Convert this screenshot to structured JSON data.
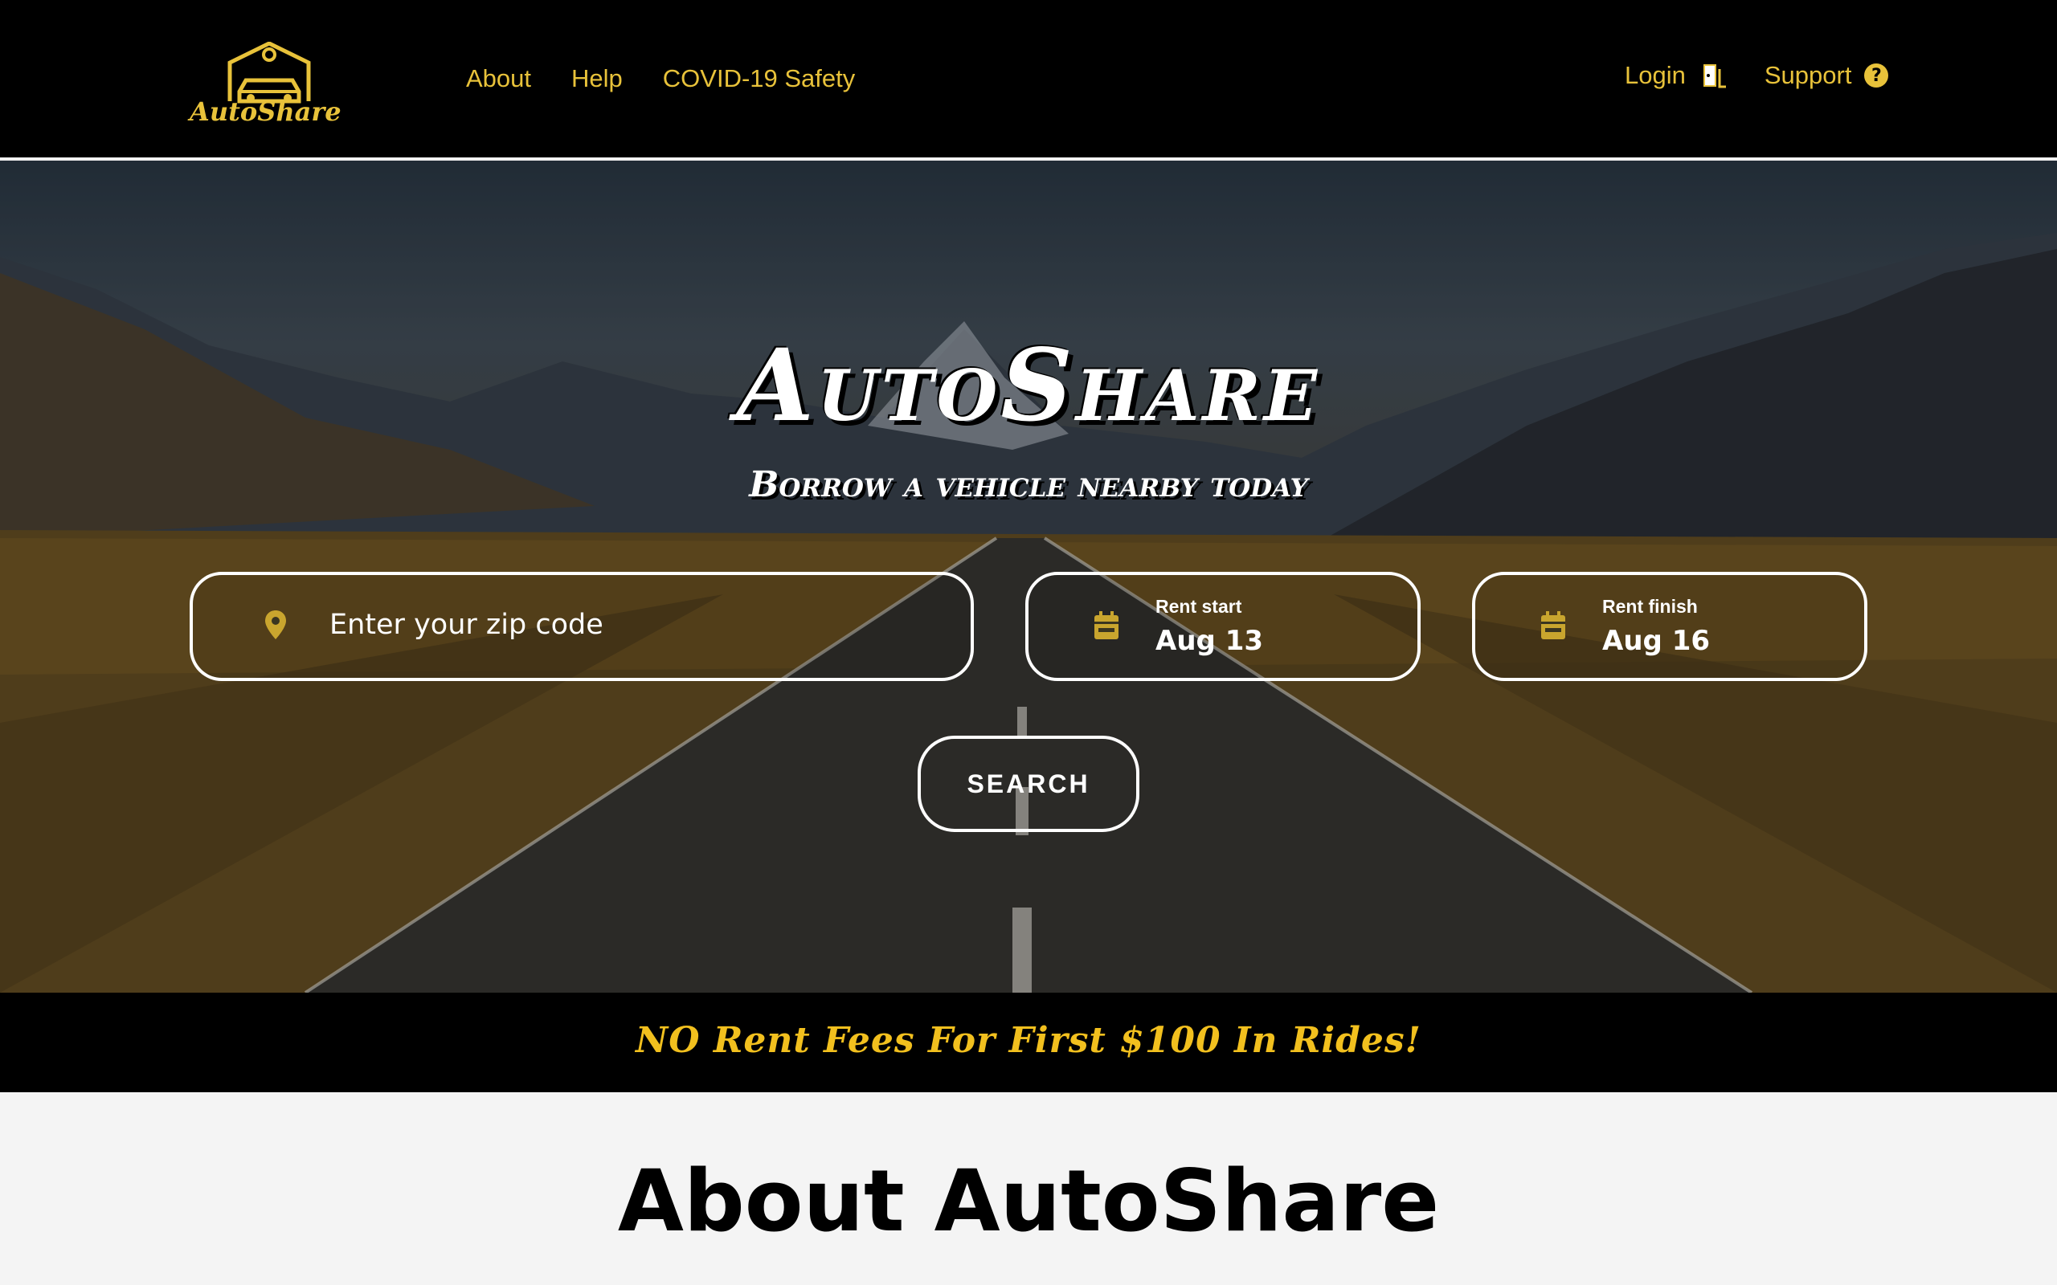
{
  "brand": {
    "logo_text": "AutoShare",
    "accent_color": "#e8c23a",
    "logo_icon": "garage-car-icon"
  },
  "nav": {
    "left": [
      "About",
      "Help",
      "COVID-19 Safety"
    ],
    "login_label": "Login",
    "login_icon": "door-exit-icon",
    "support_label": "Support",
    "support_icon": "help-circle-icon",
    "support_icon_glyph": "?"
  },
  "hero": {
    "title": "AutoShare",
    "subtitle": "Borrow a vehicle nearby today",
    "zip": {
      "placeholder": "Enter your zip code",
      "icon": "location-pin-icon"
    },
    "rent_start": {
      "label": "Rent start",
      "value": "Aug 13",
      "icon": "calendar-icon"
    },
    "rent_finish": {
      "label": "Rent finish",
      "value": "Aug 16",
      "icon": "calendar-icon"
    },
    "search_label": "SEARCH"
  },
  "promo": {
    "text": "NO Rent Fees For First $100 In Rides!",
    "color": "#f2c01e"
  },
  "about": {
    "title": "About AutoShare"
  }
}
